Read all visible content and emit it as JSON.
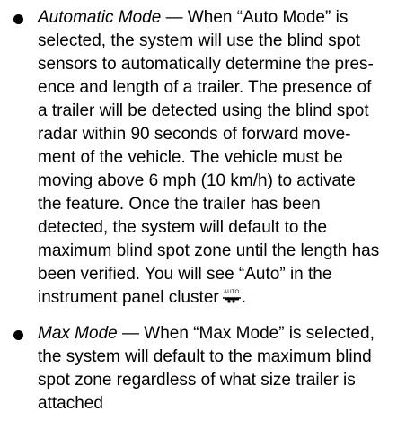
{
  "items": [
    {
      "term": "Automatic Mode",
      "lines": [
        " — When “Auto Mode” is",
        "selected, the system will use the blind spot",
        "sensors to automatically determine the pres-",
        "ence and length of a trailer. The presence of",
        "a trailer will be detected using the blind spot",
        "radar within 90 seconds of forward move-",
        "ment of the vehicle. The vehicle must be",
        "moving above 6 mph (10 km/h) to activate",
        "the feature. Once the trailer has been",
        "detected, the system will default to the",
        "maximum blind spot zone until the length has",
        "been verified. You will see “Auto” in the",
        "instrument panel cluster"
      ],
      "icon": {
        "name": "auto-trailer-icon",
        "label": "AUTO"
      },
      "end": "."
    },
    {
      "term": "Max Mode",
      "lines": [
        " — When “Max Mode” is selected,",
        "the system will default to the maximum blind",
        "spot zone regardless of what size trailer is",
        "attached"
      ]
    }
  ]
}
